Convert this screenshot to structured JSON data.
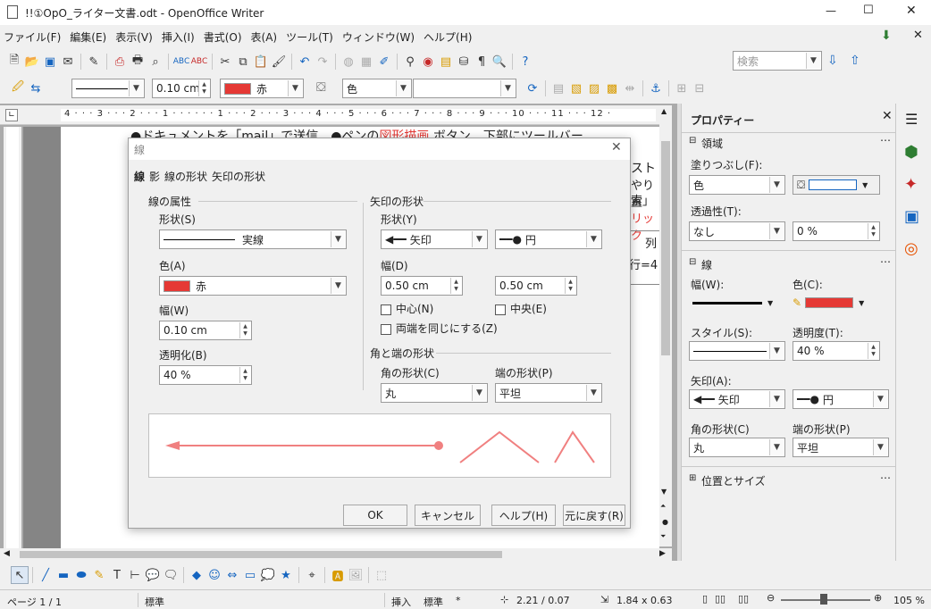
{
  "window": {
    "title": "!!①OpO_ライター文書.odt - OpenOffice Writer",
    "controls": {
      "minimize": "—",
      "maximize": "☐",
      "close": "✕"
    }
  },
  "menu": {
    "items": [
      "ファイル(F)",
      "編集(E)",
      "表示(V)",
      "挿入(I)",
      "書式(O)",
      "表(A)",
      "ツール(T)",
      "ウィンドウ(W)",
      "ヘルプ(H)"
    ],
    "close_doc": "✕"
  },
  "toolbar": {
    "search_placeholder": "検索"
  },
  "drawbar": {
    "line_width": "0.10 cm",
    "line_color": "赤",
    "fill_type": "色"
  },
  "ruler": {
    "numbers": "4 · · · 3 · · · 2 · · · 1 · · ·         · · · 1 · · · 2 · · · 3 · · · 4 · · · 5 · · · 6 · · · 7 · · · 8 · · · 9 · · · 10 · · · 11 · · · 12 ·"
  },
  "document": {
    "line1_a": "●ドキュメントを「mail」で送信…●ペンの",
    "line1_red": "図形描画",
    "line1_b": " ボタン…下部にツールバー",
    "frag1": "スト",
    "frag2": "やり直",
    "frag3": "索」",
    "frag4": "リック",
    "frag5": "列",
    "frag6": "行=4"
  },
  "dialog": {
    "title": "線",
    "tabs": [
      "線",
      "影",
      "線の形状",
      "矢印の形状"
    ],
    "line_props": {
      "heading": "線の属性",
      "style_label": "形状(S)",
      "style_value": "実線",
      "color_label": "色(A)",
      "color_value": "赤",
      "width_label": "幅(W)",
      "width_value": "0.10 cm",
      "transparency_label": "透明化(B)",
      "transparency_value": "40 %"
    },
    "arrow": {
      "heading": "矢印の形状",
      "style_label": "形状(Y)",
      "start_style": "矢印",
      "end_style": "円",
      "width_label": "幅(D)",
      "start_width": "0.50 cm",
      "end_width": "0.50 cm",
      "center_start": "中心(N)",
      "center_end": "中央(E)",
      "sync": "両端を同じにする(Z)"
    },
    "corner": {
      "heading": "角と端の形状",
      "corner_label": "角の形状(C)",
      "corner_value": "丸",
      "cap_label": "端の形状(P)",
      "cap_value": "平坦"
    },
    "buttons": {
      "ok": "OK",
      "cancel": "キャンセル",
      "help": "ヘルプ(H)",
      "reset": "元に戻す(R)"
    }
  },
  "sidebar": {
    "title": "プロパティー",
    "area": {
      "heading": "領域",
      "fill_label": "塗りつぶし(F):",
      "fill_value": "色",
      "transparency_label": "透過性(T):",
      "transparency_value": "なし",
      "transparency_pct": "0 %"
    },
    "line": {
      "heading": "線",
      "width_label": "幅(W):",
      "color_label": "色(C):",
      "style_label": "スタイル(S):",
      "transparency_label": "透明度(T):",
      "transparency_value": "40 %",
      "arrow_label": "矢印(A):",
      "arrow_start": "矢印",
      "arrow_end": "円",
      "corner_label": "角の形状(C)",
      "corner_value": "丸",
      "cap_label": "端の形状(P)",
      "cap_value": "平坦"
    },
    "position": {
      "heading": "位置とサイズ"
    }
  },
  "statusbar": {
    "page": "ページ 1 / 1",
    "style": "標準",
    "insert": "挿入",
    "sel": "標準",
    "star": "*",
    "pos": "2.21 / 0.07",
    "size": "1.84 x 0.63",
    "zoom": "105 %"
  },
  "colors": {
    "accent_red": "#e53935",
    "preview_line": "#f08080"
  }
}
